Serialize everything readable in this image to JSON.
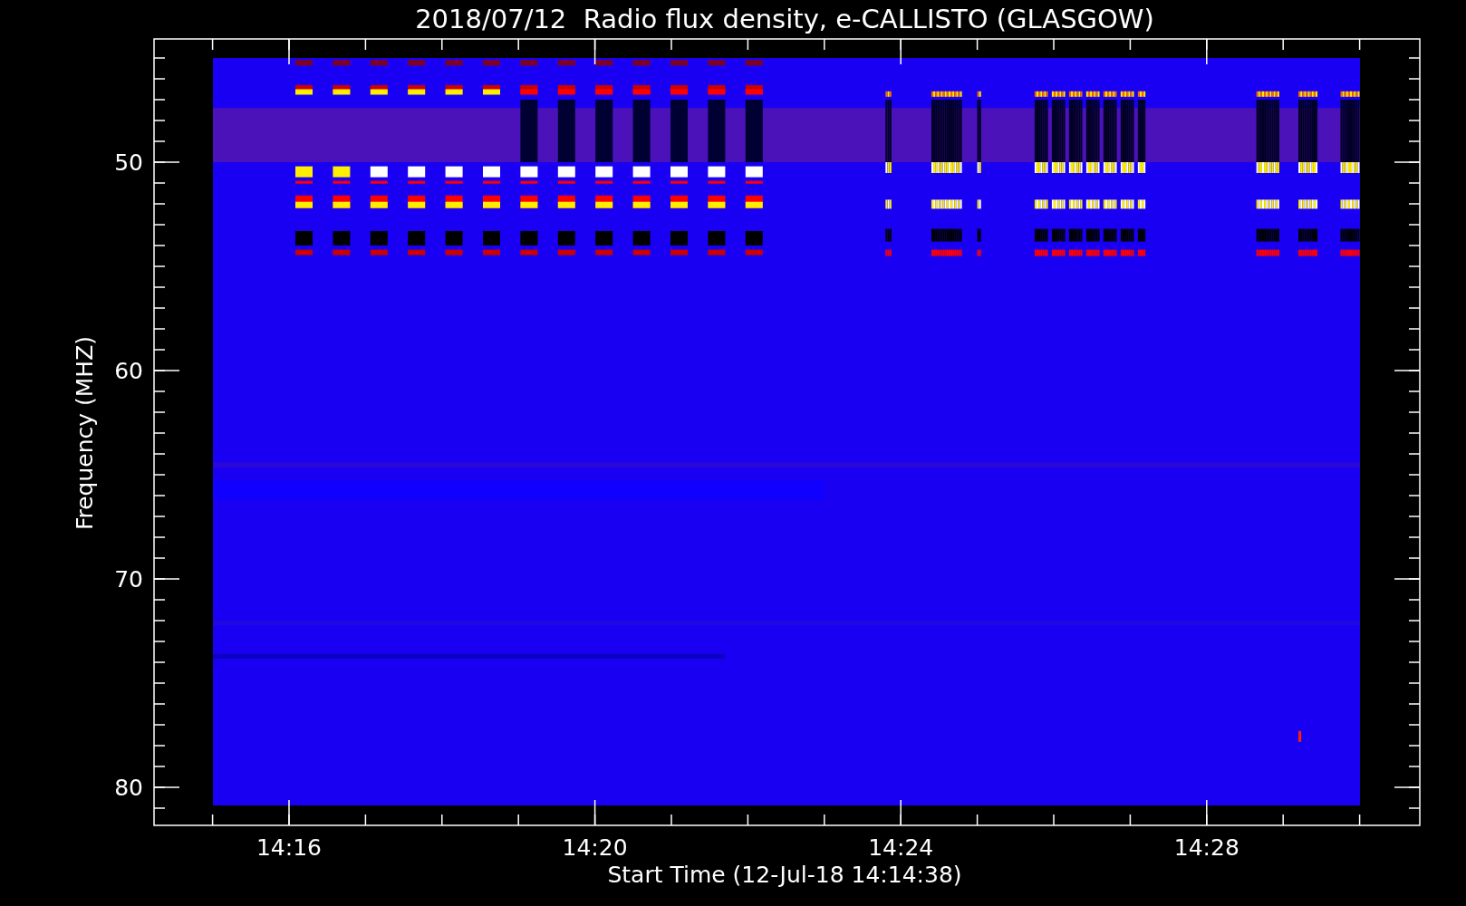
{
  "title": "2018/07/12  Radio flux density, e-CALLISTO (GLASGOW)",
  "y_axis": {
    "label": "Frequency (MHZ)",
    "ticks": [
      "50",
      "60",
      "70",
      "80"
    ]
  },
  "x_axis": {
    "label": "Start Time (12-Jul-18 14:14:38)",
    "ticks": [
      "14:16",
      "14:20",
      "14:24",
      "14:28"
    ]
  }
}
